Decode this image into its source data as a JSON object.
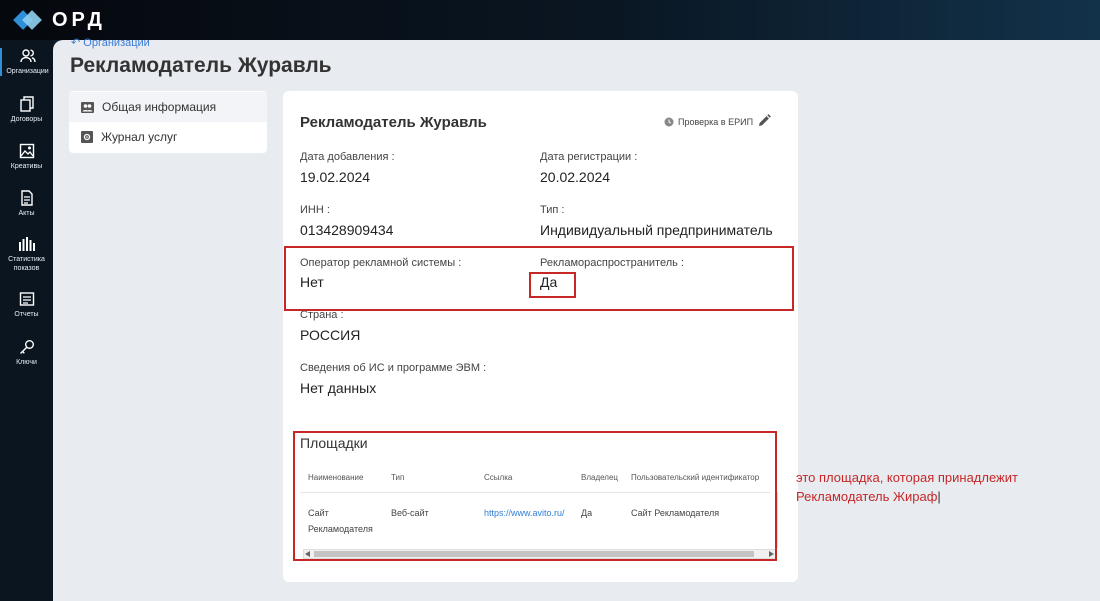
{
  "app": {
    "logo_text": "ОРД"
  },
  "sidebar": {
    "items": [
      {
        "label": "Организации",
        "icon": "users-icon"
      },
      {
        "label": "Договоры",
        "icon": "documents-icon"
      },
      {
        "label": "Креативы",
        "icon": "image-icon"
      },
      {
        "label": "Акты",
        "icon": "file-icon"
      },
      {
        "label": "Статистика показов",
        "icon": "stats-icon"
      },
      {
        "label": "Отчеты",
        "icon": "report-icon"
      },
      {
        "label": "Ключи",
        "icon": "key-icon"
      }
    ]
  },
  "breadcrumb": {
    "label": "Организации"
  },
  "page": {
    "title": "Рекламодатель Журавль"
  },
  "left_menu": {
    "items": [
      {
        "label": "Общая информация",
        "icon": "people-icon"
      },
      {
        "label": "Журнал услуг",
        "icon": "gear-icon"
      }
    ]
  },
  "card": {
    "title": "Рекламодатель Журавль",
    "erip_label": "Проверка в ЕРИП",
    "fields": {
      "date_added": {
        "label": "Дата добавления :",
        "value": "19.02.2024"
      },
      "date_registered": {
        "label": "Дата регистрации :",
        "value": "20.02.2024"
      },
      "inn": {
        "label": "ИНН :",
        "value": "013428909434"
      },
      "type": {
        "label": "Тип :",
        "value": "Индивидуальный предприниматель"
      },
      "operator": {
        "label": "Оператор рекламной системы :",
        "value": "Нет"
      },
      "distributor": {
        "label": "Рекламораспространитель :",
        "value": "Да"
      },
      "country": {
        "label": "Страна :",
        "value": "РОССИЯ"
      },
      "is_info": {
        "label": "Сведения об ИС и программе ЭВМ :",
        "value": "Нет данных"
      }
    },
    "sites": {
      "title": "Площадки",
      "columns": [
        "Наименование",
        "Тип",
        "Ссылка",
        "Владелец",
        "Пользовательский идентификатор"
      ],
      "rows": [
        {
          "name_line1": "Сайт",
          "name_line2": "Рекламодателя",
          "type": "Веб-сайт",
          "link": "https://www.avito.ru/",
          "owner": "Да",
          "user_id": "Сайт Рекламодателя"
        }
      ]
    }
  },
  "annotation": {
    "line1": "это площадка, которая принадлежит",
    "line2": "Рекламодатель Жираф"
  },
  "colors": {
    "accent": "#2f8fd8",
    "highlight": "#c62828",
    "link": "#2f7fd5"
  }
}
